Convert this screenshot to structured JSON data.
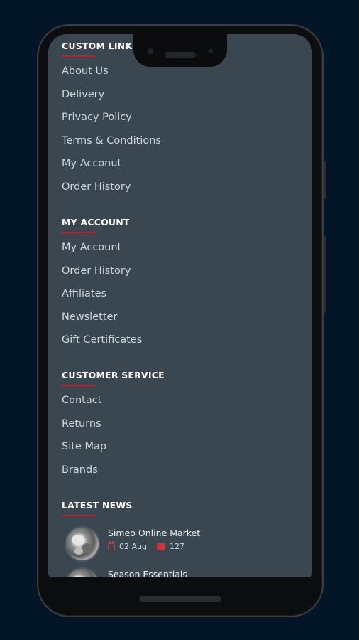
{
  "sections": [
    {
      "title": "CUSTOM LINKS",
      "links": [
        "About Us",
        "Delivery",
        "Privacy Policy",
        "Terms & Conditions",
        "My Acconut",
        "Order History"
      ]
    },
    {
      "title": "MY ACCOUNT",
      "links": [
        "My Account",
        "Order History",
        "Affiliates",
        "Newsletter",
        "Gift Certificates"
      ]
    },
    {
      "title": "CUSTOMER SERVICE",
      "links": [
        "Contact",
        "Returns",
        "Site Map",
        "Brands"
      ]
    },
    {
      "title": "LATEST NEWS",
      "news": [
        {
          "title": "Simeo Online Market",
          "date": "02 Aug",
          "comments": "127"
        },
        {
          "title": "Season Essentials"
        }
      ]
    }
  ],
  "colors": {
    "background": "#031628",
    "screen": "#3a4650",
    "accent": "#c3202e",
    "link_text": "#cfd6dc"
  },
  "icons": [
    "calendar-icon",
    "comment-icon"
  ]
}
